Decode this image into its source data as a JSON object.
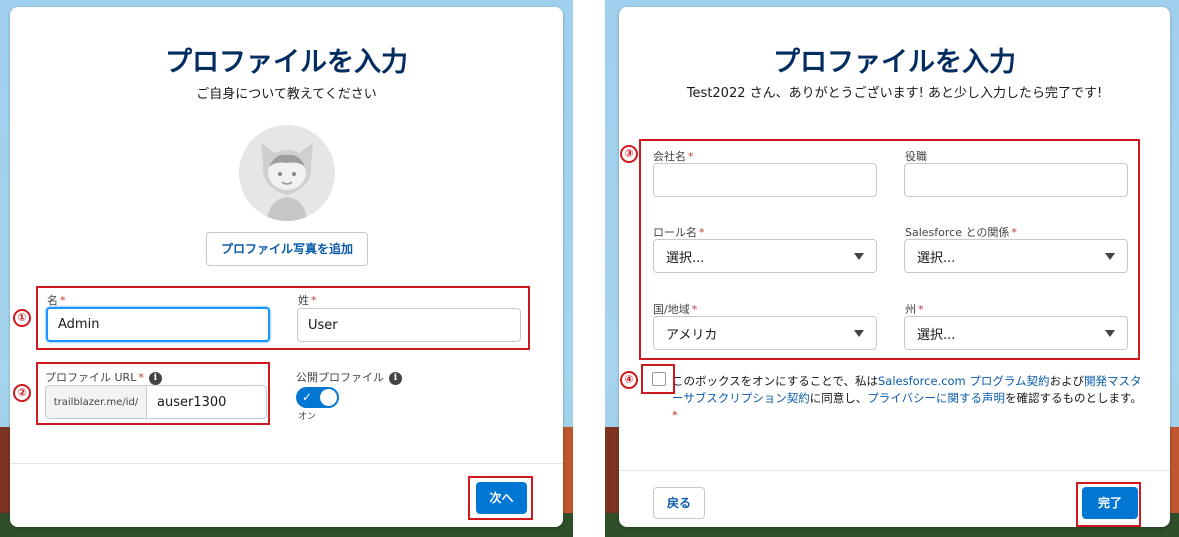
{
  "left": {
    "title": "プロファイルを入力",
    "subtitle": "ご自身について教えてください",
    "add_photo_label": "プロファイル写真を追加",
    "first_name": {
      "label": "名",
      "value": "Admin"
    },
    "last_name": {
      "label": "姓",
      "value": "User"
    },
    "profile_url": {
      "label": "プロファイル URL",
      "prefix": "trailblazer.me/id/",
      "value": "auser1300"
    },
    "public_profile": {
      "label": "公開プロファイル",
      "toggle_state": "オン"
    },
    "next_label": "次へ",
    "markers": {
      "m1": "①",
      "m2": "②"
    }
  },
  "right": {
    "title": "プロファイルを入力",
    "subtitle": "Test2022 さん、ありがとうございます! あと少し入力したら完了です!",
    "company": {
      "label": "会社名",
      "value": ""
    },
    "job_title": {
      "label": "役職",
      "value": ""
    },
    "role": {
      "label": "ロール名",
      "value": "選択..."
    },
    "relationship": {
      "label": "Salesforce との関係",
      "value": "選択..."
    },
    "country": {
      "label": "国/地域",
      "value": "アメリカ"
    },
    "state": {
      "label": "州",
      "value": "選択..."
    },
    "terms": {
      "t1": "このボックスをオンにすることで、私は",
      "l1": "Salesforce.com プログラム契約",
      "t2": "および",
      "l2": "開発マスターサブスクリプション契約",
      "t3": "に同意し、",
      "l3": "プライバシーに関する声明",
      "t4": "を確認するものとします。"
    },
    "required_mark": "*",
    "back_label": "戻る",
    "finish_label": "完了",
    "markers": {
      "m3": "③",
      "m4": "④"
    }
  },
  "colors": {
    "brand": "#0176d3",
    "title": "#032d60",
    "annotation": "#d0191f",
    "link": "#0b5cab"
  }
}
